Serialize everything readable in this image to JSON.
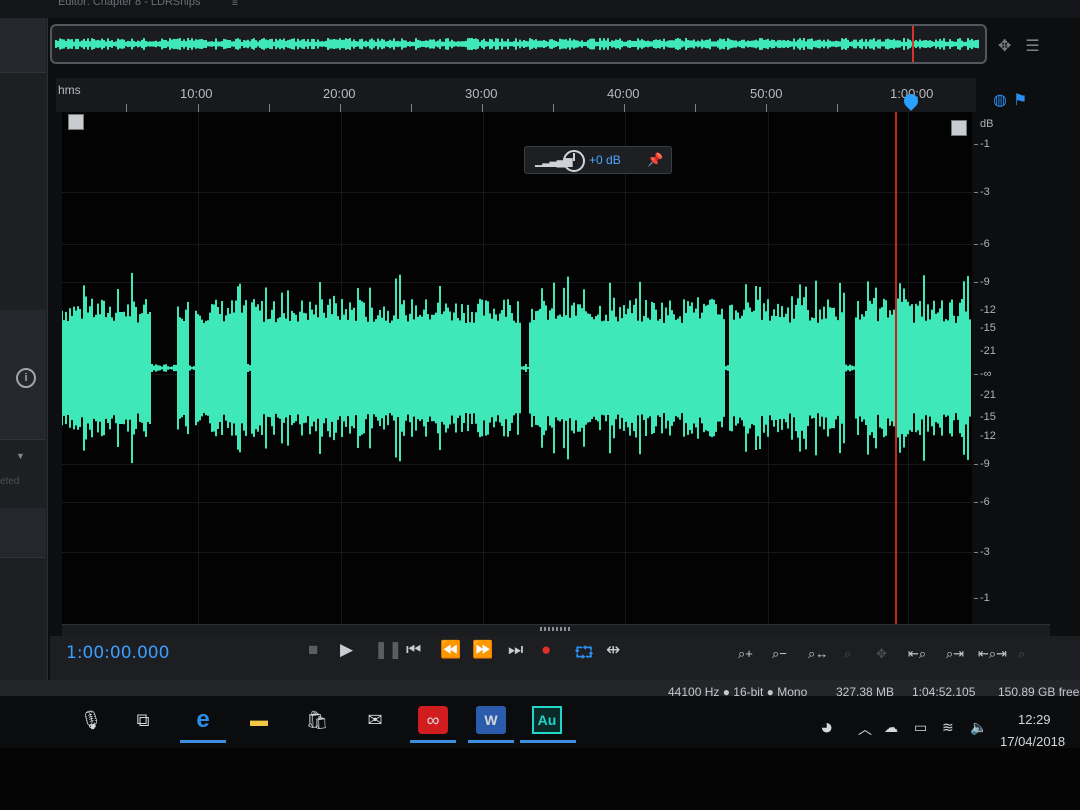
{
  "title_bar": {
    "text": "Editor: Chapter 8 - LDRShips",
    "menu_icon": "hamburger-icon"
  },
  "left_panel": {
    "info_icon": "info-icon",
    "faded_label": "eted"
  },
  "overview": {
    "right_icons": [
      "zoom-selector-icon",
      "menu-icon"
    ]
  },
  "ruler": {
    "unit_label": "hms",
    "labels": [
      "10:00",
      "20:00",
      "30:00",
      "40:00",
      "50:00",
      "1:00:00"
    ]
  },
  "ruler_icons": [
    "headphones-icon",
    "marker-icon"
  ],
  "hud": {
    "gain_value": "+0 dB"
  },
  "db_scale": {
    "unit": "dB",
    "labels": [
      "-1",
      "-3",
      "-6",
      "-9",
      "-12",
      "-15",
      "-21",
      "-∞",
      "-21",
      "-15",
      "-12",
      "-9",
      "-6",
      "-3",
      "-1"
    ]
  },
  "transport": {
    "time": "1:00:00.000",
    "buttons": [
      "stop",
      "play",
      "pause",
      "go-to-start",
      "rewind",
      "fast-forward",
      "go-to-end",
      "record",
      "loop-playback",
      "skip-selection"
    ]
  },
  "status_bar": {
    "format": "44100 Hz ● 16-bit ● Mono",
    "size": "327.38 MB",
    "duration": "1:04:52.105",
    "free_space": "150.89 GB free"
  },
  "taskbar": {
    "apps": [
      "microphone",
      "task-view",
      "edge",
      "file-explorer",
      "store",
      "mail",
      "creative-cloud",
      "word",
      "audition"
    ],
    "audition_label": "Au",
    "clock_time": "12:29",
    "clock_date": "17/04/2018"
  },
  "colors": {
    "waveform": "#3fe8b8",
    "accent": "#3c9dff",
    "playhead": "#d8332a"
  }
}
